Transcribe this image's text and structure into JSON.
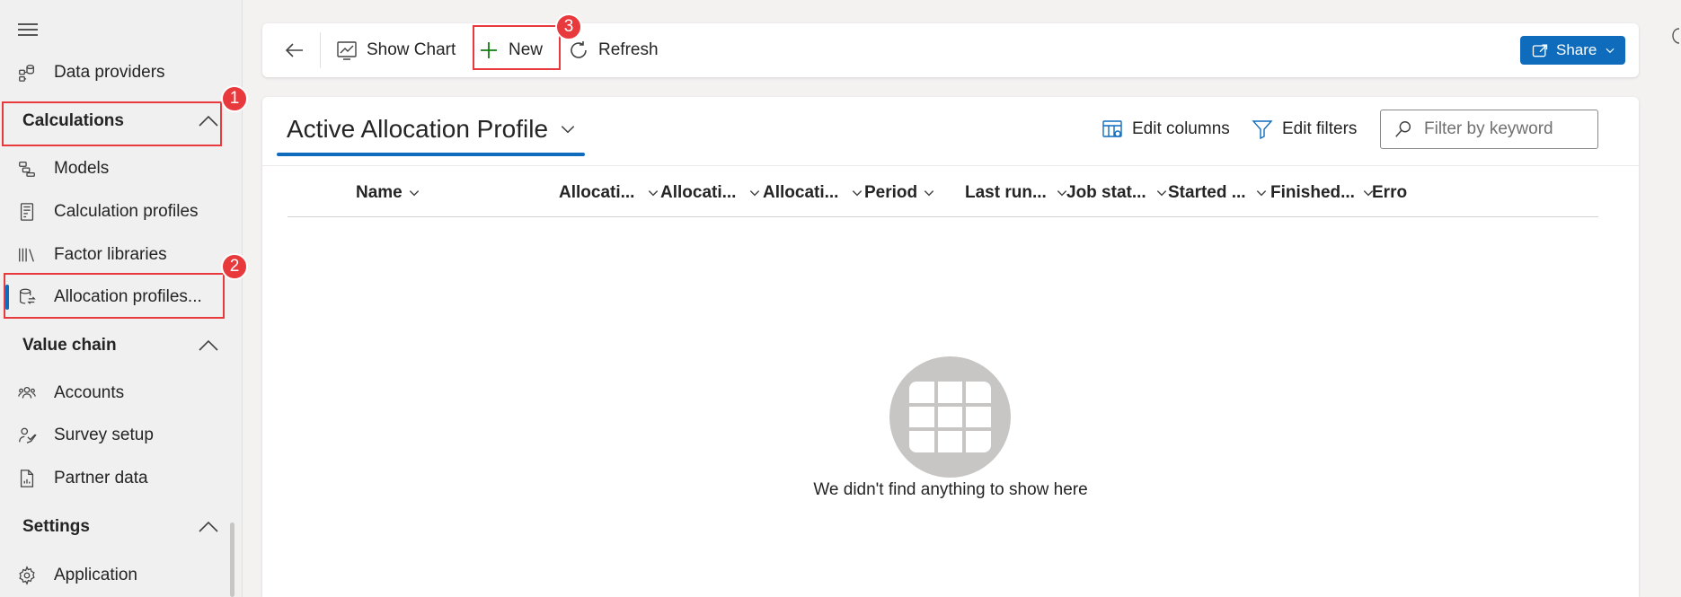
{
  "sidebar": {
    "items_top": [
      {
        "label": "Data providers",
        "icon": "data-providers-icon"
      }
    ],
    "groups": [
      {
        "title": "Calculations",
        "items": [
          {
            "label": "Models",
            "icon": "models-icon"
          },
          {
            "label": "Calculation profiles",
            "icon": "calculation-profiles-icon"
          },
          {
            "label": "Factor libraries",
            "icon": "factor-libraries-icon"
          },
          {
            "label": "Allocation profiles...",
            "icon": "allocation-profiles-icon"
          }
        ]
      },
      {
        "title": "Value chain",
        "items": [
          {
            "label": "Accounts",
            "icon": "accounts-icon"
          },
          {
            "label": "Survey setup",
            "icon": "survey-setup-icon"
          },
          {
            "label": "Partner data",
            "icon": "partner-data-icon"
          }
        ]
      },
      {
        "title": "Settings",
        "items": [
          {
            "label": "Application",
            "icon": "gear-icon"
          }
        ]
      }
    ]
  },
  "toolbar": {
    "show_chart": "Show Chart",
    "new": "New",
    "refresh": "Refresh",
    "share": "Share"
  },
  "view": {
    "title": "Active Allocation Profile",
    "edit_columns": "Edit columns",
    "edit_filters": "Edit filters",
    "filter_placeholder": "Filter by keyword",
    "columns": [
      "Name",
      "Allocati...",
      "Allocati...",
      "Allocati...",
      "Period",
      "Last run...",
      "Job stat...",
      "Started ...",
      "Finished...",
      "Erro"
    ],
    "empty_message": "We didn't find anything to show here"
  },
  "annotations": [
    "1",
    "2",
    "3"
  ],
  "colors": {
    "accent": "#0f6cbd",
    "annotation": "#e8393d",
    "new_plus": "#107c10"
  }
}
